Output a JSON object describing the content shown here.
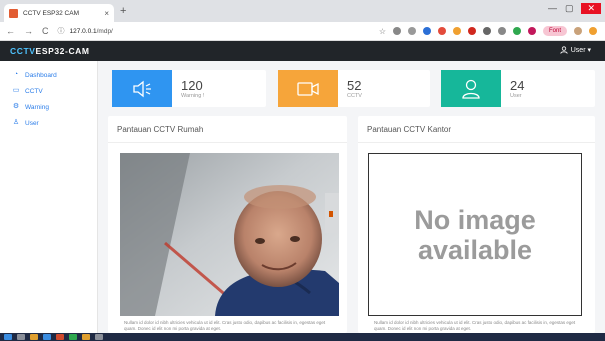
{
  "browser": {
    "tab_title": "CCTV ESP32 CAM",
    "tab_close": "×",
    "new_tab": "+",
    "url_host": "127.0.0.1",
    "url_path": "/mdp/",
    "back": "←",
    "forward": "→",
    "reload": "C",
    "minimize": "—",
    "maximize": "▢",
    "close": "✕",
    "profile_label": "Font"
  },
  "app": {
    "brand_part1": "CCTV",
    "brand_part2": "ESP32-CAM",
    "user_menu": "User ▾"
  },
  "sidebar": {
    "items": [
      {
        "label": "Dashboard",
        "icon": "dashboard-icon"
      },
      {
        "label": "CCTV",
        "icon": "camera-icon"
      },
      {
        "label": "Warning",
        "icon": "gear-icon"
      },
      {
        "label": "User",
        "icon": "user-icon"
      }
    ]
  },
  "stats": [
    {
      "value": "120",
      "label": "Warning !",
      "color": "#2f95f1",
      "icon": "speaker-icon"
    },
    {
      "value": "52",
      "label": "CCTV",
      "color": "#f6a53a",
      "icon": "video-camera-icon"
    },
    {
      "value": "24",
      "label": "User",
      "color": "#16b79a",
      "icon": "user-icon"
    }
  ],
  "panels": [
    {
      "title": "Pantauan CCTV Rumah",
      "caption": "Nullam id dolor id nibh ultricies vehicula ut id elit. Cras justo odio, dapibus ac facilisis in, egestas eget quam. Donec id elit non mi porta gravida at eget."
    },
    {
      "title": "Pantauan CCTV Kantor",
      "no_image_line1": "No image",
      "no_image_line2": "available",
      "caption": "Nullam id dolor id nibh ultricies vehicula ut id elit. Cras justo odio, dapibus ac facilisis in, egestas eget quam. Donec id elit non mi porta gravida at eget."
    }
  ]
}
